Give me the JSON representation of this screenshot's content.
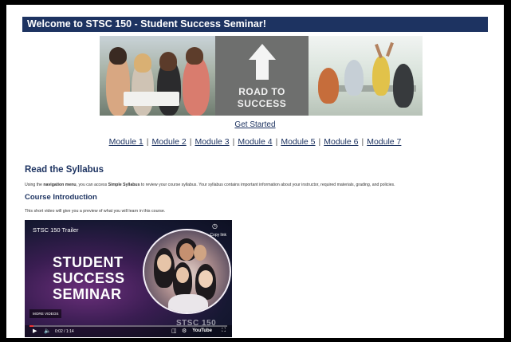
{
  "banner": {
    "title": "Welcome to STSC 150 - Student Success Seminar!"
  },
  "hero": {
    "road_line1": "ROAD TO",
    "road_line2": "SUCCESS"
  },
  "nav": {
    "get_started": "Get Started",
    "modules": [
      "Module 1",
      "Module 2",
      "Module 3",
      "Module 4",
      "Module 5",
      "Module 6",
      "Module 7"
    ],
    "separator": "|"
  },
  "syllabus": {
    "heading": "Read the Syllabus",
    "text_pre": "Using the ",
    "text_bold1": "navigation menu",
    "text_mid": ", you can access ",
    "text_bold2": "Simple Syllabus",
    "text_post": " to review your course syllabus. Your syllabus contains important information about your instructor, required materials, grading, and policies."
  },
  "intro": {
    "heading": "Course Introduction",
    "text": "This short video will give you a preview of what you will learn in this course."
  },
  "video": {
    "trailer_label": "STSC 150 Trailer",
    "copy_label": "Copy link",
    "title_lines": [
      "STUDENT",
      "SUCCESS",
      "SEMINAR"
    ],
    "more_videos": "MORE VIDEOS",
    "time": "0:02 / 1:14",
    "logo": "STSC 150",
    "youtube": "YouTube",
    "progress": 0.02
  },
  "colors": {
    "navy": "#1d3361",
    "link": "#1d3361"
  }
}
